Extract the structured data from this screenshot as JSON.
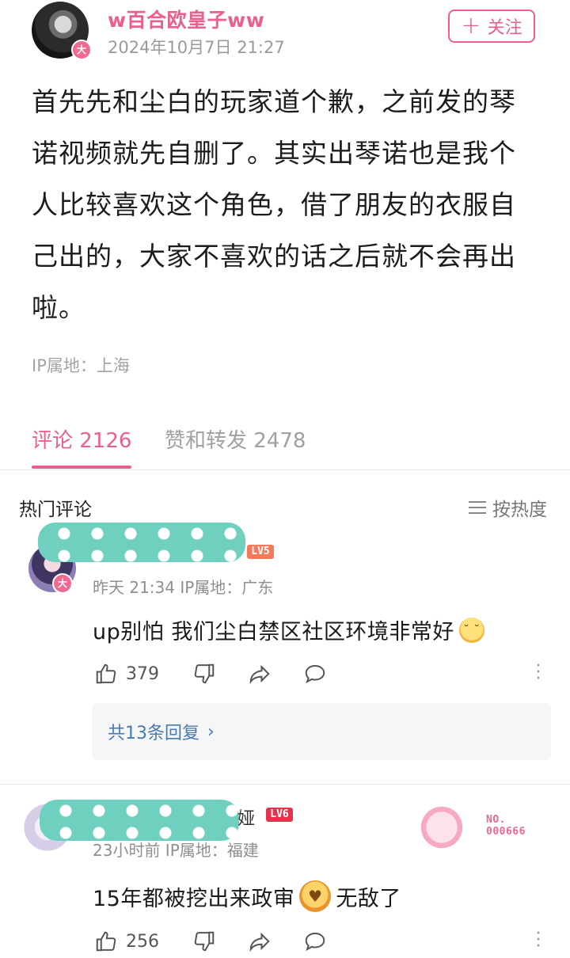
{
  "post": {
    "author": "w百合欧皇子ww",
    "badge": "大",
    "date": "2024年10月7日 21:27",
    "follow_label": "关注",
    "body": "首先先和尘白的玩家道个歉，之前发的琴诺视频就先自删了。其实出琴诺也是我个人比较喜欢这个角色，借了朋友的衣服自己出的，大家不喜欢的话之后就不会再出啦。",
    "ip": "IP属地：上海"
  },
  "tabs": {
    "comments": "评论 2126",
    "likes": "赞和转发 2478"
  },
  "hot": {
    "title": "热门评论",
    "sort_label": "按热度"
  },
  "comments": [
    {
      "badge": "大",
      "level": "LV5",
      "meta": "昨天 21:34  IP属地：广东",
      "text": "up别怕 我们尘白禁区社区环境非常好",
      "likes": "379",
      "replies": "共13条回复"
    },
    {
      "name_tail": "娅",
      "level": "LV6",
      "meta": "23小时前  IP属地：福建",
      "text_before": "15年都被挖出来政审",
      "text_after": "无敌了",
      "likes": "256",
      "decor_no": "NO.\n000666"
    }
  ],
  "icons": {
    "like": "thumbs-up-icon",
    "dislike": "thumbs-down-icon",
    "share": "share-icon",
    "reply": "comment-bubble-icon",
    "more": "more-vertical-icon",
    "sort": "menu-lines-icon",
    "chevron": "chevron-right-icon"
  },
  "colors": {
    "accent": "#ec5f8c",
    "link": "#4b79b0"
  }
}
